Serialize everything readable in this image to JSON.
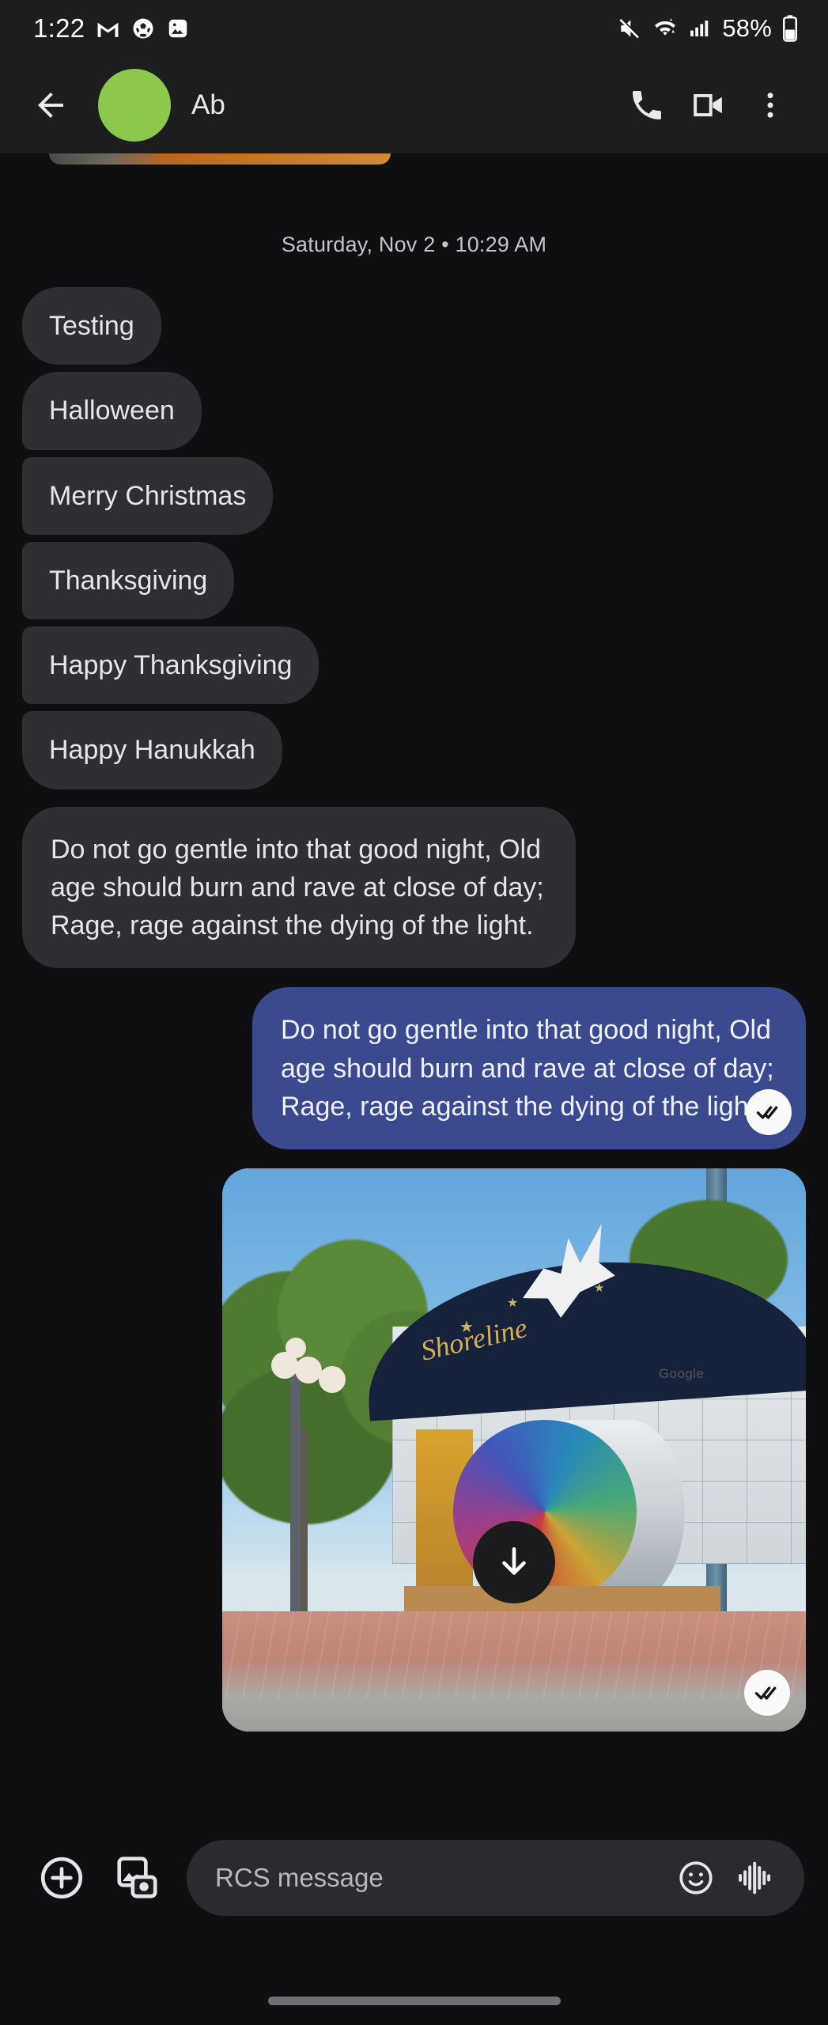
{
  "status_bar": {
    "time": "1:22",
    "battery": "58%",
    "left_icons": [
      "gmail-icon",
      "soccer-ball-icon",
      "photos-icon"
    ],
    "right_icons": [
      "mute-icon",
      "wifi-icon",
      "signal-icon",
      "battery-icon"
    ]
  },
  "app_bar": {
    "back_label": "back-arrow",
    "contact_name": "Ab",
    "avatar_color": "#8bc84b",
    "call_label": "call",
    "video_label": "video call",
    "overflow_label": "more options"
  },
  "thread": {
    "day_stamp": "Saturday, Nov 2 • 10:29 AM",
    "messages": [
      {
        "id": "m1",
        "side": "in",
        "group": "solo",
        "text": "Testing"
      },
      {
        "id": "m2",
        "side": "in",
        "group": "first",
        "text": "Halloween"
      },
      {
        "id": "m3",
        "side": "in",
        "group": "mid",
        "text": "Merry Christmas"
      },
      {
        "id": "m4",
        "side": "in",
        "group": "mid",
        "text": "Thanksgiving"
      },
      {
        "id": "m5",
        "side": "in",
        "group": "mid",
        "text": "Happy Thanksgiving"
      },
      {
        "id": "m6",
        "side": "in",
        "group": "last",
        "text": "Happy Hanukkah"
      },
      {
        "id": "m7",
        "side": "in",
        "group": "solo",
        "text": "Do not go gentle into that good night, Old age should burn and rave at close of day; Rage, rage against the dying of the light."
      },
      {
        "id": "m8",
        "side": "out",
        "group": "solo",
        "text": "Do not go gentle into that good night, Old age should burn and rave at close of day; Rage, rage against the dying of the light.",
        "receipt": "read"
      }
    ],
    "photo": {
      "alt": "Shoreline Amphitheatre entrance with colorful Android sculpture",
      "sign_text": "Shoreline",
      "logo_text": "Google",
      "download_label": "download",
      "receipt": "read"
    }
  },
  "compose": {
    "add_label": "add attachment",
    "gallery_label": "gallery and camera",
    "placeholder": "RCS message",
    "emoji_label": "emoji",
    "voice_label": "voice message"
  },
  "colors": {
    "background": "#0f0f11",
    "bar": "#1d1d20",
    "incoming_bubble": "#2f2f33",
    "outgoing_bubble": "#3b4a8e",
    "accent_green": "#8bc84b"
  }
}
